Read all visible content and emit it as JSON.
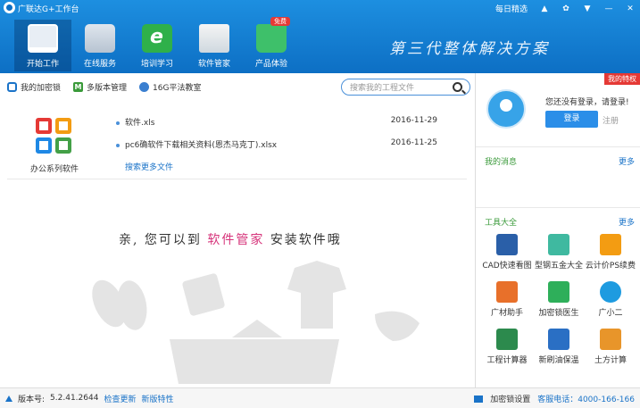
{
  "window": {
    "title": "广联达G+工作台",
    "daily_pick": "每日精选",
    "controls": [
      "bell-icon",
      "settings-icon",
      "menu-down-icon",
      "minimize-icon",
      "close-icon"
    ]
  },
  "nav": {
    "items": [
      {
        "label": "开始工作",
        "icon": "monitor-icon",
        "active": true
      },
      {
        "label": "在线服务",
        "icon": "cloud-service-icon"
      },
      {
        "label": "培训学习",
        "icon": "training-icon"
      },
      {
        "label": "软件管家",
        "icon": "software-manager-icon"
      },
      {
        "label": "产品体验",
        "icon": "shopping-bag-icon"
      }
    ],
    "badge": "免费",
    "slogan": "第三代整体解决方案"
  },
  "toolbar": {
    "items": [
      {
        "label": "我的加密锁",
        "icon": "lock-icon"
      },
      {
        "label": "多版本管理",
        "icon": "multi-version-icon"
      },
      {
        "label": "16G平法教室",
        "icon": "classroom-icon"
      }
    ],
    "search_placeholder": "搜索我的工程文件"
  },
  "office": {
    "label": "办公系列软件"
  },
  "files": {
    "items": [
      {
        "name": "软件.xls",
        "date": "2016-11-29"
      },
      {
        "name": "pc6确软件下载相关资料(恩杰马克丁).xlsx",
        "date": "2016-11-25"
      }
    ],
    "more": "搜索更多文件"
  },
  "tip": {
    "before": "亲, 您可以到",
    "highlight": "软件管家",
    "after": "安装软件哦"
  },
  "account": {
    "vip": "我的特权",
    "prompt": "您还没有登录，请登录!",
    "login": "登录",
    "register": "注册"
  },
  "messages": {
    "title": "我的消息",
    "more": "更多"
  },
  "tools": {
    "title": "工具大全",
    "more": "更多",
    "items": [
      {
        "label": "CAD快速看图",
        "icon": "cad-icon",
        "color": "#2a5fa8"
      },
      {
        "label": "型钢五金大全",
        "icon": "steel-icon",
        "color": "#3fb9a0"
      },
      {
        "label": "云计价PS续费",
        "icon": "cloud-pricing-icon",
        "color": "#f39c12"
      },
      {
        "label": "广材助手",
        "icon": "material-helper-icon",
        "color": "#e8702a"
      },
      {
        "label": "加密锁医生",
        "icon": "lock-doctor-icon",
        "color": "#2eaf5a"
      },
      {
        "label": "广小二",
        "icon": "assistant-icon",
        "color": "#1e9be0"
      },
      {
        "label": "工程计算器",
        "icon": "calculator-icon",
        "color": "#2c8a4d"
      },
      {
        "label": "新刷油保温",
        "icon": "paint-icon",
        "color": "#2a6fc4"
      },
      {
        "label": "土方计算",
        "icon": "earthwork-icon",
        "color": "#e8952a"
      }
    ]
  },
  "status": {
    "version_label": "版本号:",
    "version": "5.2.41.2644",
    "check_update": "检查更新",
    "new_features": "新版特性",
    "lock_settings": "加密锁设置",
    "hotline": "客服电话：4000-166-166"
  }
}
